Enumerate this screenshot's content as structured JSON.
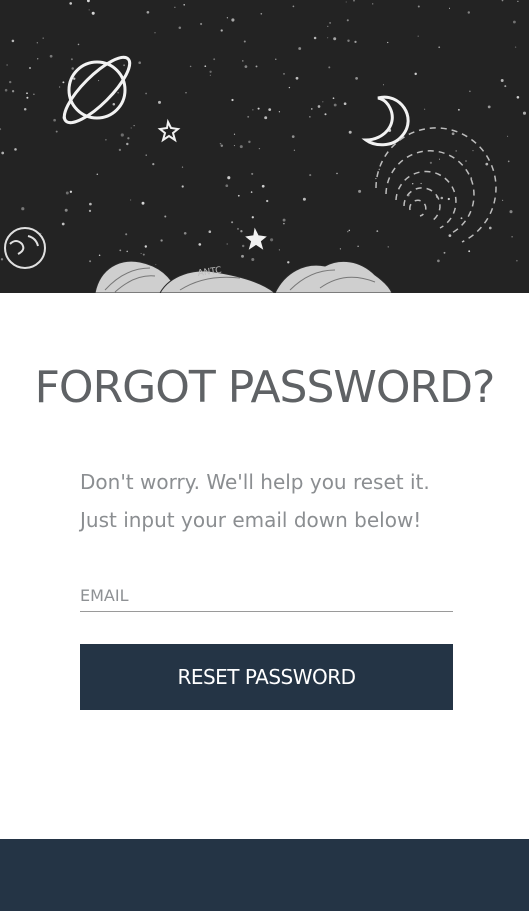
{
  "hero": {
    "signature": "ANTC"
  },
  "main": {
    "title": "FORGOT PASSWORD?",
    "description_line1": "Don't worry. We'll help you reset it.",
    "description_line2": "Just input your email down below!"
  },
  "form": {
    "email_placeholder": "EMAIL",
    "email_value": "",
    "submit_label": "RESET PASSWORD"
  },
  "colors": {
    "accent": "#243445",
    "hero_background": "#232323",
    "title_text": "#5f6265",
    "body_text": "#8b8e91"
  }
}
